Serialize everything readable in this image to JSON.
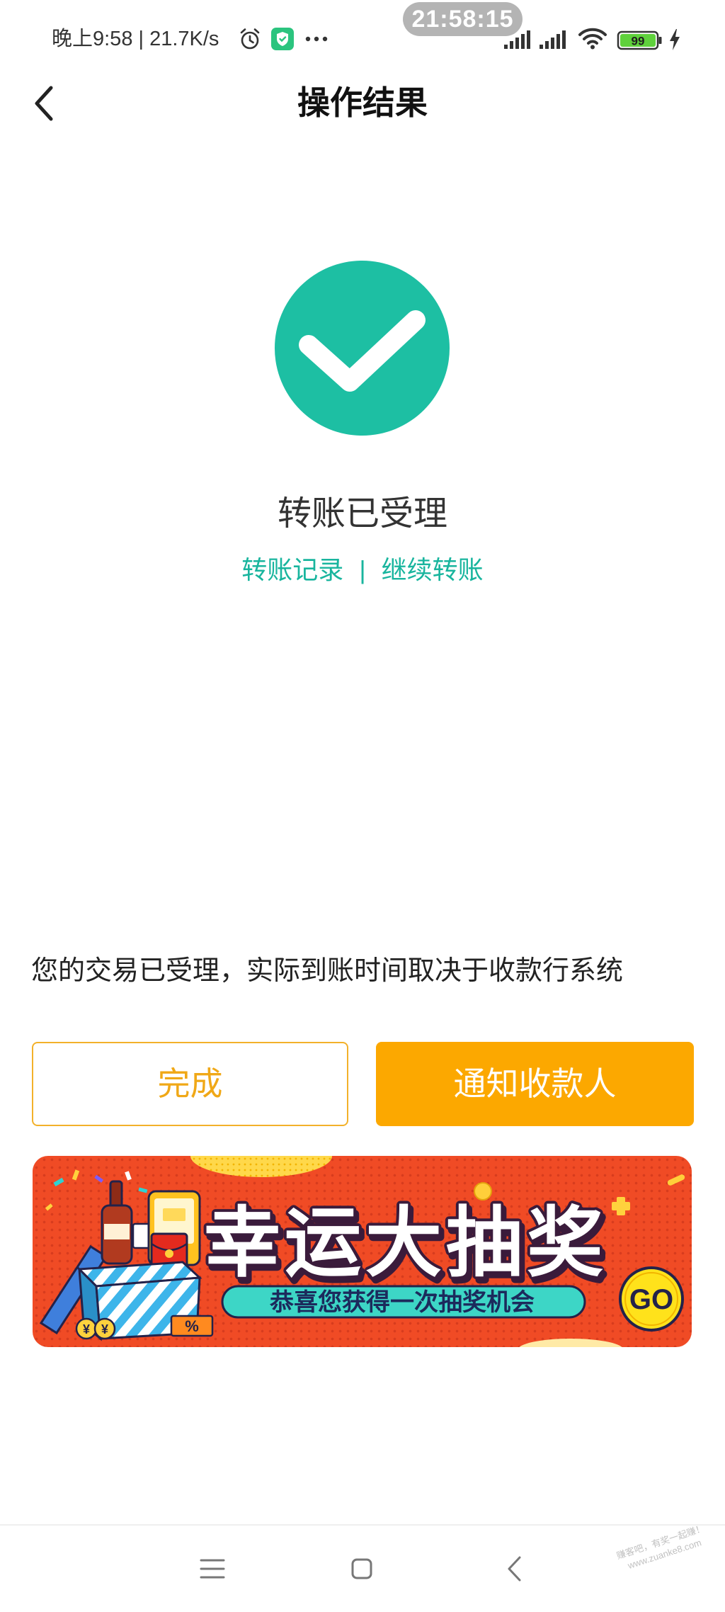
{
  "status_bar": {
    "left_text": "晚上9:58 | 21.7K/s",
    "clock": "21:58:15",
    "battery_level": "99"
  },
  "nav": {
    "title": "操作结果"
  },
  "result": {
    "status": "转账已受理",
    "links": [
      "转账记录",
      "继续转账"
    ],
    "divider": "|"
  },
  "notice": "您的交易已受理，实际到账时间取决于收款行系统",
  "actions": {
    "done": "完成",
    "notify": "通知收款人"
  },
  "banner": {
    "title": "幸运大抽奖",
    "subtitle": "恭喜您获得一次抽奖机会",
    "go": "GO",
    "coin_symbol": "¥",
    "discount_tag": "%"
  },
  "watermark": {
    "line1": "赚客吧，有奖一起赚！",
    "line2": "www.zuanke8.com"
  },
  "colors": {
    "success_teal": "#1dbfa3",
    "link_teal": "#19b59e",
    "primary_orange": "#fca800",
    "outline_orange": "#f3b12a",
    "banner_red": "#f04b25",
    "battery_green": "#5fd13c"
  },
  "icons": {
    "status_alarm": "alarm-clock-icon",
    "status_app": "shield-app-icon",
    "status_more": "more-dots-icon",
    "signal": "signal-bars-icon",
    "wifi": "wifi-icon",
    "battery": "battery-icon",
    "charging": "charging-bolt-icon",
    "back": "chevron-left-icon",
    "result": "check-circle-icon",
    "nav_menu": "menu-icon",
    "nav_home": "home-square-icon",
    "nav_back": "back-chevron-icon"
  }
}
